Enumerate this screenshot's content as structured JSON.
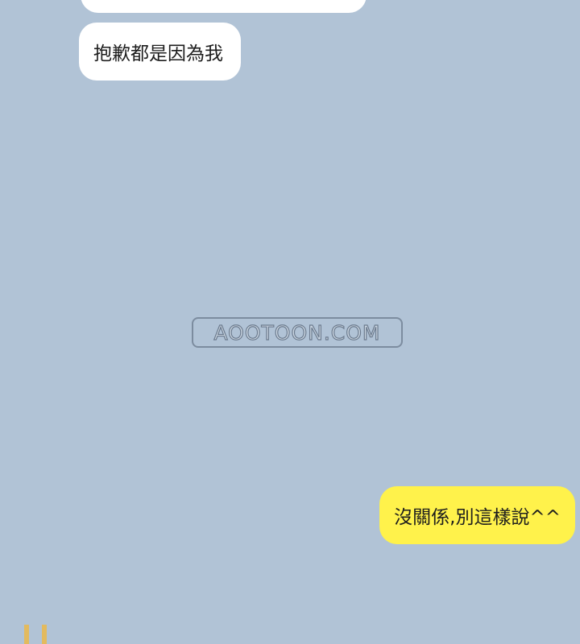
{
  "chat": {
    "messages": [
      {
        "side": "incoming",
        "text": ""
      },
      {
        "side": "incoming",
        "text": "抱歉都是因為我"
      },
      {
        "side": "outgoing",
        "text": "沒關係,別這樣說^^"
      }
    ]
  },
  "watermark": {
    "text": "AOOTOON.COM"
  },
  "colors": {
    "background": "#b1c3d6",
    "incoming_bubble": "#ffffff",
    "outgoing_bubble": "#fff24b",
    "text": "#1d1d1d"
  }
}
